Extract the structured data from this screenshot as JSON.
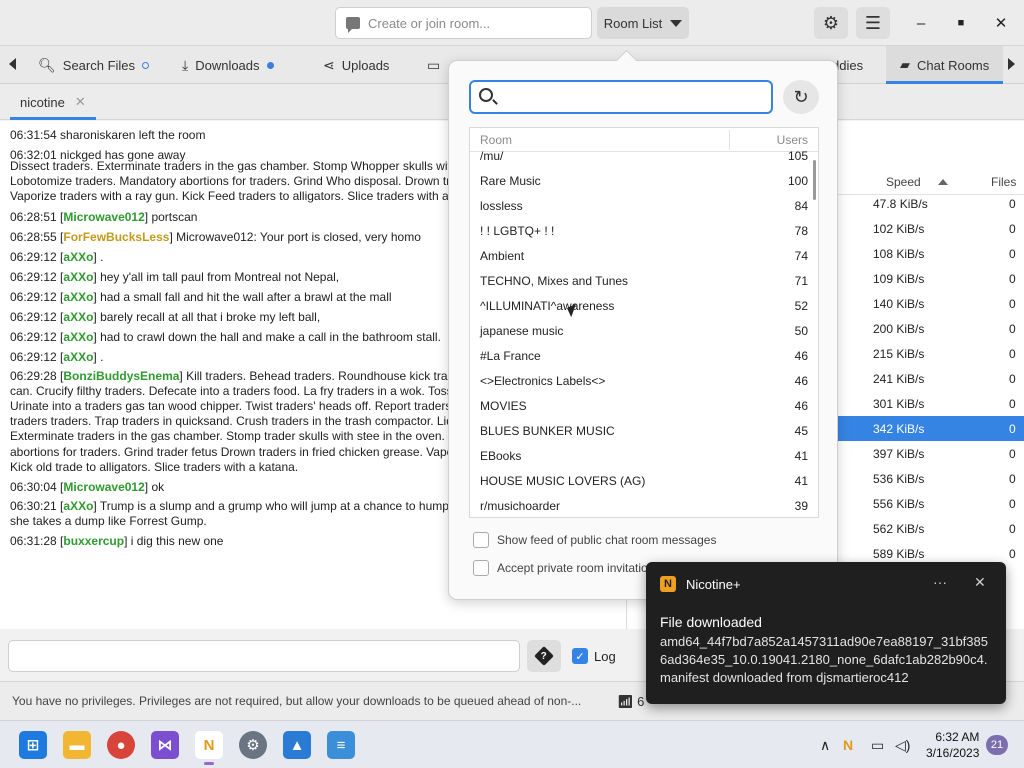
{
  "header": {
    "room_placeholder": "Create or join room...",
    "room_list_label": "Room List",
    "settings_icon": "gear-icon",
    "menu_icon": "hamburger-icon"
  },
  "tabs": [
    {
      "label": "Search Files",
      "indicator": "ring"
    },
    {
      "label": "Downloads",
      "indicator": "dot"
    },
    {
      "label": "Uploads"
    },
    {
      "label": "ddies"
    },
    {
      "label": "Chat Rooms",
      "active": true
    }
  ],
  "room_tab": {
    "label": "nicotine"
  },
  "chat": {
    "l1": "06:31:54 sharoniskaren left the room",
    "l2": "06:32:01 nickged has gone away",
    "l3": "Dissect traders. Exterminate traders in the gas chamber. Stomp Whopper skulls with traders in the oven. Lobotomize traders. Mandatory abortions for traders. Grind Who disposal. Drown traders in fried chicken grease. Vaporize traders with a ray gun. Kick Feed traders to alligators. Slice traders with a katana.",
    "l4_time": "06:28:51 [",
    "l4_user": "Microwave012",
    "l4_msg": "] portscan",
    "l5_time": "06:28:55 [",
    "l5_user": "ForFewBucksLess",
    "l5_msg": "] Microwave012: Your port is closed, very homo",
    "l6_time": "06:29:12 [",
    "l6_user": "aXXo",
    "l6_msg": "] .",
    "l7_time": "06:29:12 [",
    "l7_user": "aXXo",
    "l7_msg": "] hey y'all im tall paul from Montreal not Nepal,",
    "l8_time": "06:29:12 [",
    "l8_user": "aXXo",
    "l8_msg": "] had a small fall and hit the wall after a brawl at the mall",
    "l9_time": "06:29:12 [",
    "l9_user": "aXXo",
    "l9_msg": "] barely recall at all that i broke my left ball,",
    "l10_time": "06:29:12 [",
    "l10_user": "aXXo",
    "l10_msg": "] had to crawl down the hall and make a call in the bathroom stall.",
    "l11_time": "06:29:12 [",
    "l11_user": "aXXo",
    "l11_msg": "] .",
    "l12_time": "06:29:28 [",
    "l12_user": "BonziBuddysEnema",
    "l12_msg": "] Kill traders. Behead traders. Roundhouse kick traders trader baby into the trash can. Crucify filthy traders. Defecate into a traders food. La fry traders in a wok. Toss traders into active volcanoes. Urinate into a traders gas tan wood chipper. Twist traders' heads off. Report traders to the IRS. Karate chop traders traders. Trap traders in quicksand. Crush traders in the trash compactor. Liquefy trad Dissect traders. Exterminate traders in the gas chamber. Stomp trader skulls with stee in the oven. Lobotomize traders. Mandatory abortions for traders. Grind trader fetus Drown traders in fried chicken grease. Vaporize traders with a ray gun. Kick old trade to alligators. Slice traders with a katana.",
    "l13_time": "06:30:04 [",
    "l13_user": "Microwave012",
    "l13_msg": "] ok",
    "l14_time": "06:30:21 [",
    "l14_user": "aXXo",
    "l14_msg": "] Trump is a slump and a grump who will jump at a chance to hump a rump with his stump after she takes a dump like Forrest Gump.",
    "l15_time": "06:31:28 [",
    "l15_user": "buxxercup",
    "l15_msg": "] i dig this new one"
  },
  "users": {
    "col_speed": "Speed",
    "col_files": "Files",
    "rows": [
      {
        "speed": "47.8 KiB/s",
        "files": "0"
      },
      {
        "speed": "102 KiB/s",
        "files": "0"
      },
      {
        "speed": "108 KiB/s",
        "files": "0"
      },
      {
        "speed": "109 KiB/s",
        "files": "0"
      },
      {
        "speed": "140 KiB/s",
        "files": "0"
      },
      {
        "speed": "200 KiB/s",
        "files": "0"
      },
      {
        "speed": "215 KiB/s",
        "files": "0"
      },
      {
        "speed": "241 KiB/s",
        "files": "0"
      },
      {
        "speed": "301 KiB/s",
        "files": "0"
      },
      {
        "speed": "342 KiB/s",
        "files": "0",
        "selected": true
      },
      {
        "speed": "397 KiB/s",
        "files": "0"
      },
      {
        "speed": "536 KiB/s",
        "files": "0"
      },
      {
        "speed": "556 KiB/s",
        "files": "0"
      },
      {
        "speed": "562 KiB/s",
        "files": "0"
      },
      {
        "speed": "589 KiB/s",
        "files": "0"
      }
    ]
  },
  "input": {
    "log_label": "Log"
  },
  "status": {
    "message": "You have no privileges. Privileges are not required, but allow your downloads to be queued ahead of non-...",
    "conn_count": "6"
  },
  "roomlist": {
    "col_room": "Room",
    "col_users": "Users",
    "rooms": [
      {
        "name": "/mu/",
        "users": "105"
      },
      {
        "name": "Rare Music",
        "users": "100"
      },
      {
        "name": "lossless",
        "users": "84"
      },
      {
        "name": "! ! LGBTQ+ ! !",
        "users": "78"
      },
      {
        "name": "Ambient",
        "users": "74"
      },
      {
        "name": "TECHNO, Mixes and Tunes",
        "users": "71"
      },
      {
        "name": "^ILLUMINATI^awareness",
        "users": "52"
      },
      {
        "name": "japanese music",
        "users": "50"
      },
      {
        "name": "#La France",
        "users": "46"
      },
      {
        "name": "<>Electronics Labels<>",
        "users": "46"
      },
      {
        "name": "MOVIES",
        "users": "46"
      },
      {
        "name": "BLUES BUNKER MUSIC",
        "users": "45"
      },
      {
        "name": "EBooks",
        "users": "41"
      },
      {
        "name": "HOUSE MUSIC LOVERS (AG)",
        "users": "41"
      },
      {
        "name": "r/musichoarder",
        "users": "39"
      }
    ],
    "opt_feed": "Show feed of public chat room messages",
    "opt_private": "Accept private room invitatio"
  },
  "toast": {
    "app": "Nicotine+",
    "title": "File downloaded",
    "body": "amd64_44f7bd7a852a1457311ad90e7ea88197_31bf3856ad364e35_10.0.19041.2180_none_6dafc1ab282b90c4.manifest downloaded from djsmartieroc412"
  },
  "taskbar": {
    "time": "6:32 AM",
    "date": "3/16/2023",
    "badge": "21"
  }
}
